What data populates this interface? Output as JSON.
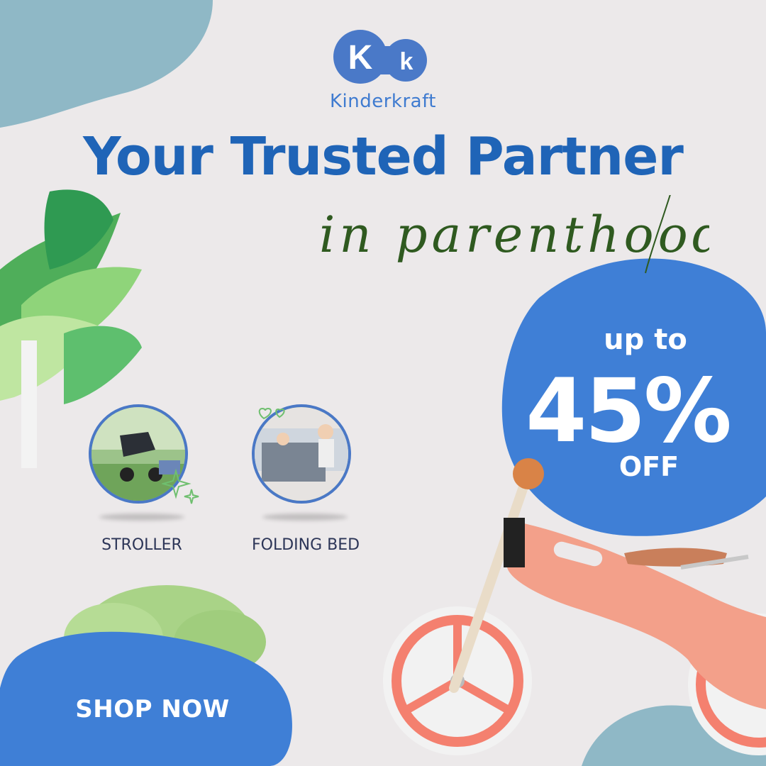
{
  "brand": {
    "logo_letters": "K k",
    "name": "Kinderkraft",
    "color": "#4a79c8"
  },
  "headline": {
    "title": "Your Trusted Partner",
    "subtitle": "in parenthood",
    "title_color": "#1f64b7",
    "subtitle_color": "#2f5a20"
  },
  "promo": {
    "line1": "up to",
    "amount": "45%",
    "line3": "OFF",
    "blob_color": "#3f7fd6"
  },
  "categories": [
    {
      "label": "STROLLER",
      "photo": "stroller-photo"
    },
    {
      "label": "FOLDING BED",
      "photo": "folding-bed-photo"
    }
  ],
  "cta": {
    "label": "SHOP NOW",
    "color": "#3f7fd6"
  },
  "product": {
    "name": "balance-bike",
    "frame_color": "#f3a08a",
    "wheel_color": "#f47a6c"
  },
  "decor": {
    "icons": [
      "palm-leaves",
      "green-bush",
      "sparkle-icon",
      "heart-icon"
    ],
    "accent_blue": "#86b4c6"
  }
}
